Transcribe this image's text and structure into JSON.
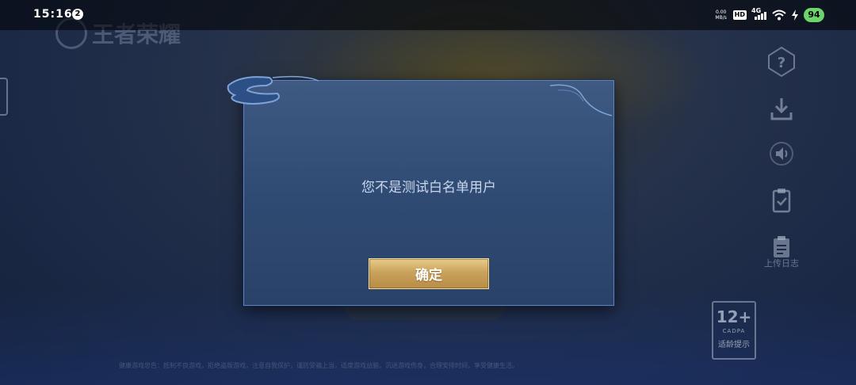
{
  "status_bar": {
    "time": "15:16",
    "notification_count": "2",
    "network_speed": "0.00\nMB/s",
    "hd_label": "HD",
    "network_type": "4G",
    "battery": "94",
    "battery_color": "#6dd46b"
  },
  "background": {
    "logo_text": "王者荣耀",
    "side_menu": {
      "icons": [
        "help-icon",
        "download-icon",
        "sound-icon",
        "clipboard-icon",
        "upload-log-icon"
      ],
      "upload_log_label": "上传日志"
    },
    "age_badge": {
      "rating": "12+",
      "org": "CADPA",
      "label": "适龄提示"
    },
    "footer_text": "健康游戏忠告：抵制不良游戏，拒绝盗版游戏，注意自我保护，谨防受骗上当，适度游戏益脑，沉迷游戏伤身，合理安排时间，享受健康生活。"
  },
  "dialog": {
    "message": "您不是测试白名单用户",
    "confirm_label": "确定",
    "accent_color": "#c9a25c",
    "panel_color": "#2f4a72"
  }
}
